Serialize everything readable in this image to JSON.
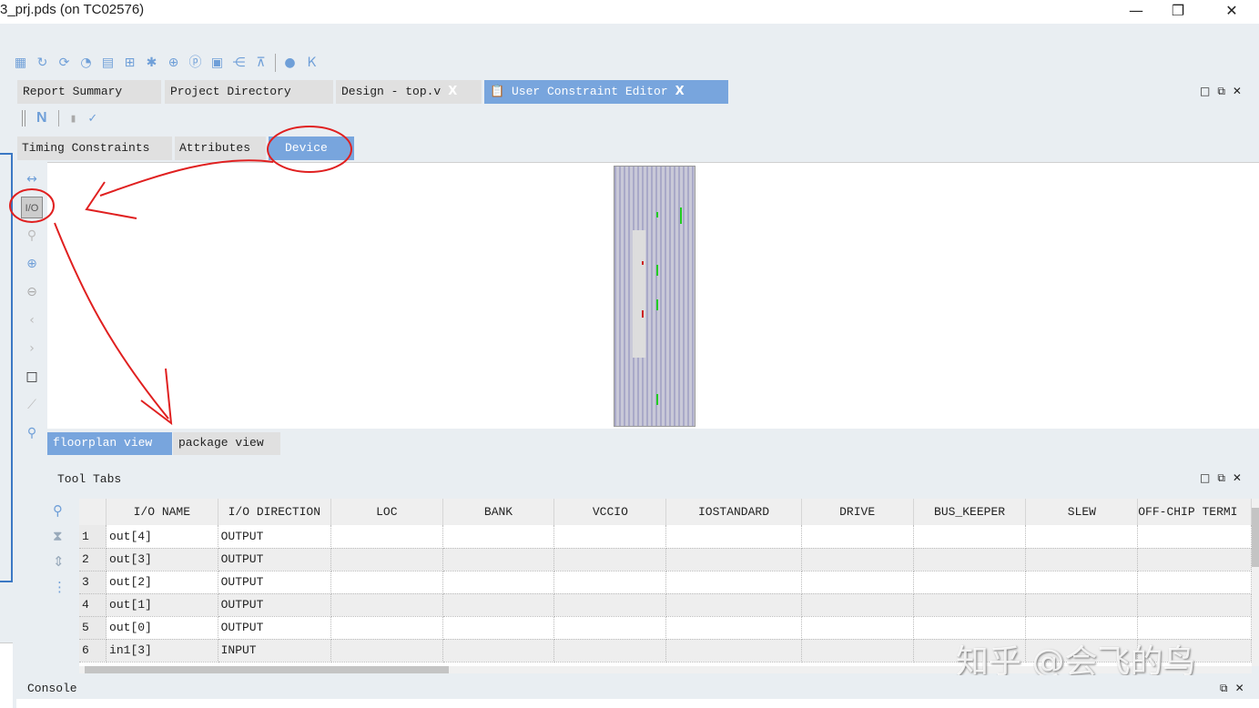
{
  "window": {
    "title": "3_prj.pds (on TC02576)",
    "minimize": "—",
    "restore": "❐",
    "close": "✕"
  },
  "toolbar_icons": [
    "report-icon",
    "refresh-icon",
    "rerun-icon",
    "sync-icon",
    "table-icon",
    "chip-icon",
    "debug-icon",
    "download-icon",
    "ip-icon",
    "waveform-icon",
    "network-icon",
    "hierarchy-icon",
    "bulb-icon",
    "flag-icon"
  ],
  "tabs": [
    {
      "label": "Report Summary"
    },
    {
      "label": "Project Directory"
    },
    {
      "label": "Design - top.v",
      "close": "X"
    },
    {
      "label": "User Constraint Editor",
      "close": "X",
      "active": true
    }
  ],
  "editor_toolbar": {
    "new": "N"
  },
  "subtabs": [
    {
      "label": "Timing Constraints"
    },
    {
      "label": "Attributes"
    },
    {
      "label": "Device",
      "active": true
    }
  ],
  "side_tools": {
    "io": "I/O"
  },
  "view_tabs": [
    {
      "label": "floorplan view",
      "active": true
    },
    {
      "label": "package view"
    }
  ],
  "tool_tabs": {
    "title": "Tool Tabs"
  },
  "table": {
    "columns": [
      "I/O NAME",
      "I/O DIRECTION",
      "LOC",
      "BANK",
      "VCCIO",
      "IOSTANDARD",
      "DRIVE",
      "BUS_KEEPER",
      "SLEW",
      "OFF-CHIP TERMI"
    ],
    "rows": [
      [
        "1",
        "out[4]",
        "OUTPUT"
      ],
      [
        "2",
        "out[3]",
        "OUTPUT"
      ],
      [
        "3",
        "out[2]",
        "OUTPUT"
      ],
      [
        "4",
        "out[1]",
        "OUTPUT"
      ],
      [
        "5",
        "out[0]",
        "OUTPUT"
      ],
      [
        "6",
        "in1[3]",
        "INPUT"
      ]
    ]
  },
  "console": {
    "title": "Console"
  },
  "watermark": "知乎 @会飞的鸟",
  "colors": {
    "accent": "#78a5dd",
    "annotation": "#e02020"
  }
}
